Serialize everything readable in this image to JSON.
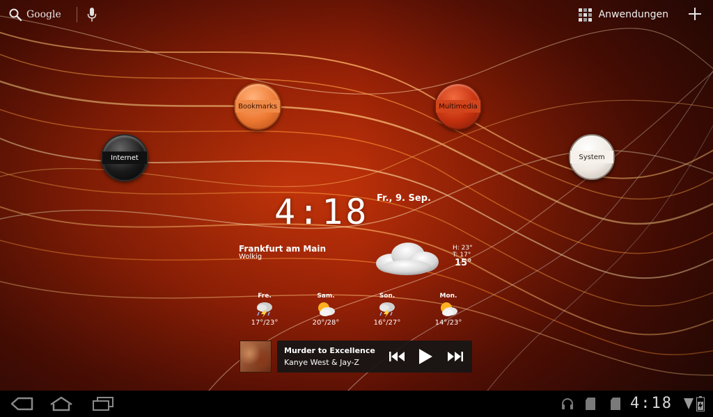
{
  "top_bar": {
    "search_label": "Google",
    "apps_label": "Anwendungen"
  },
  "bubbles": {
    "internet": "Internet",
    "bookmarks": "Bookmarks",
    "multimedia": "Multimedia",
    "system": "System"
  },
  "clock": {
    "time": "4:18",
    "date": "Fr., 9. Sep."
  },
  "weather": {
    "city": "Frankfurt am Main",
    "condition": "Wolkig",
    "high": "H:  23°",
    "low": "T:  17°",
    "current": "15°",
    "forecast": [
      {
        "day": "Fre.",
        "range": "17°/23°",
        "icon": "thunderstorm-icon"
      },
      {
        "day": "Sam.",
        "range": "20°/28°",
        "icon": "partly-sunny-icon"
      },
      {
        "day": "Son.",
        "range": "16°/27°",
        "icon": "thunderstorm-icon"
      },
      {
        "day": "Mon.",
        "range": "14°/23°",
        "icon": "partly-sunny-icon"
      }
    ]
  },
  "music": {
    "title": "Murder to Excellence",
    "artist": "Kanye West & Jay-Z"
  },
  "status_bar": {
    "time": "4:18"
  },
  "colors": {
    "wallpaper_base": "#9a2206",
    "wave": "#ff9a40",
    "system_bar": "#000000"
  }
}
